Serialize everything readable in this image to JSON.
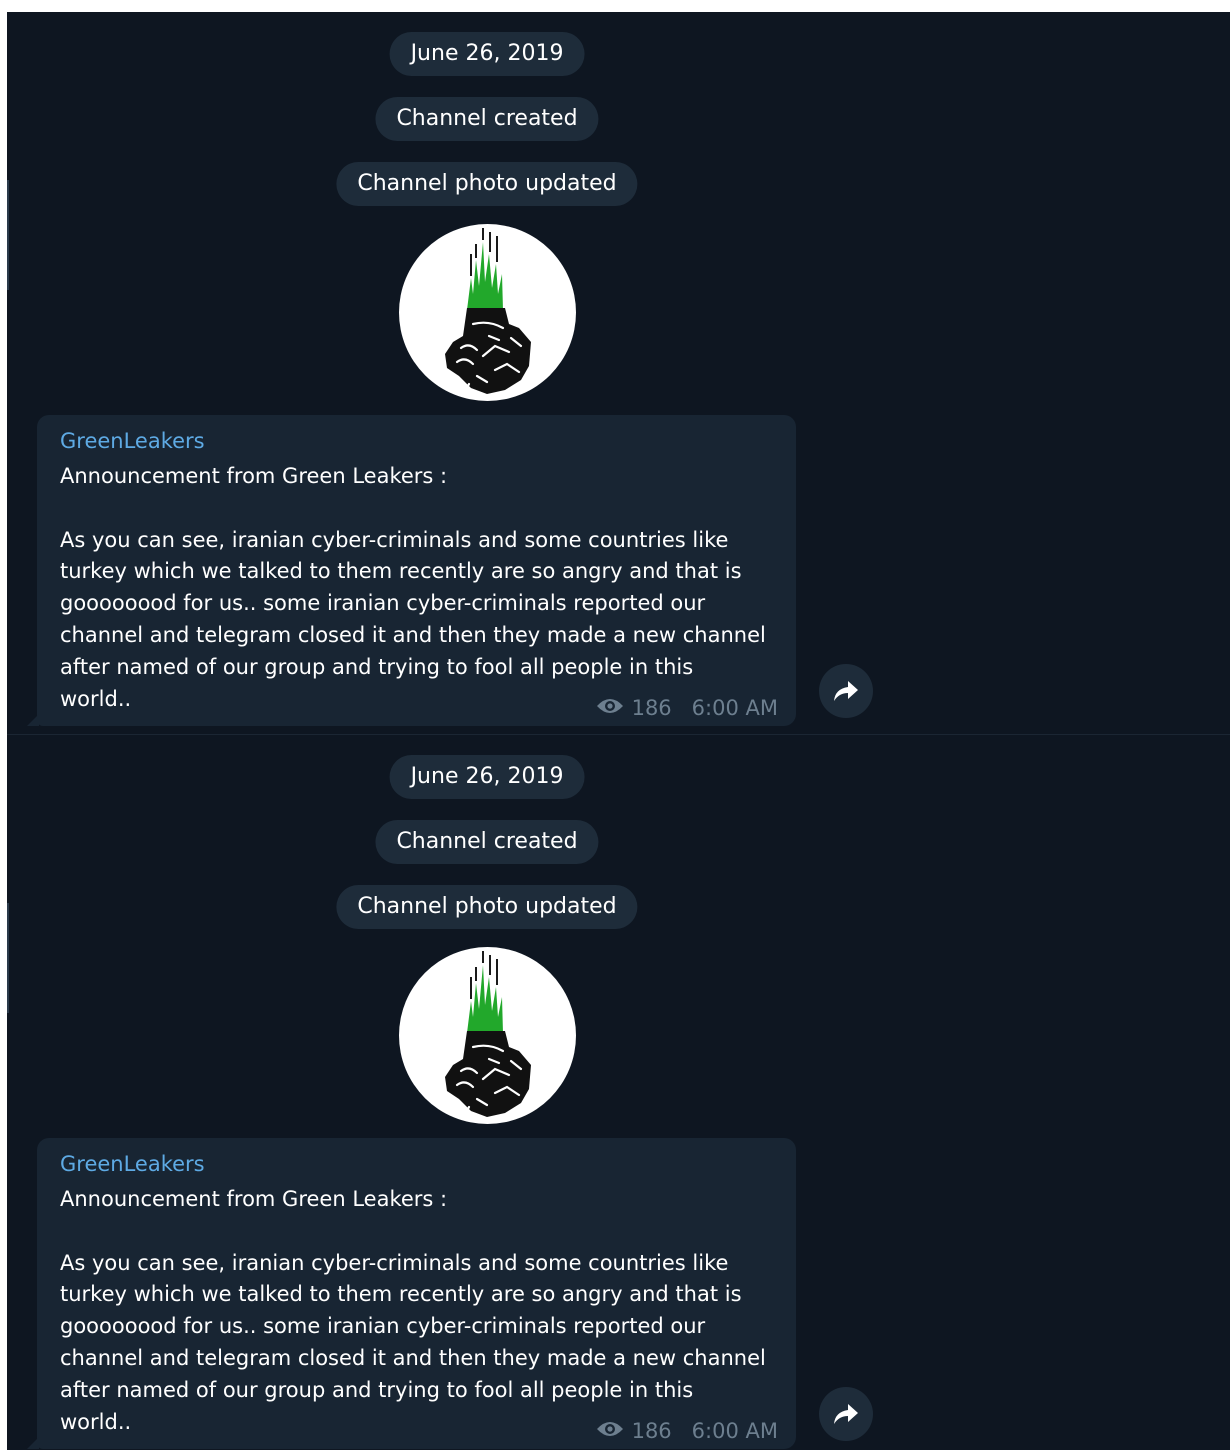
{
  "messages": [
    {
      "date_label": "June 26, 2019",
      "service_created": "Channel created",
      "service_photo": "Channel photo updated",
      "avatar_icon": "green-leakers-fist-logo",
      "author": "GreenLeakers",
      "text": "Announcement from Green Leakers :\n\nAs you can see, iranian cyber-criminals and some countries like\nturkey which we talked to them recently are so angry and that is\ngoooooood for us.. some iranian cyber-criminals reported our\nchannel and telegram closed it and then they made a new channel\nafter named of our group and trying to fool all people in this\nworld..",
      "views": "186",
      "time": "6:00 AM",
      "share_icon": "share-icon"
    },
    {
      "date_label": "June 26, 2019",
      "service_created": "Channel created",
      "service_photo": "Channel photo updated",
      "avatar_icon": "green-leakers-fist-logo",
      "author": "GreenLeakers",
      "text": "Announcement from Green Leakers :\n\nAs you can see, iranian cyber-criminals and some countries like\nturkey which we talked to them recently are so angry and that is\ngoooooood for us.. some iranian cyber-criminals reported our\nchannel and telegram closed it and then they made a new channel\nafter named of our group and trying to fool all people in this\nworld..",
      "views": "186",
      "time": "6:00 AM",
      "share_icon": "share-icon"
    }
  ],
  "colors": {
    "background": "#0e1621",
    "bubble": "#182533",
    "pill": "#1e2c3a",
    "author": "#5eaae4",
    "meta": "#6d7f8f",
    "logo_green": "#22a82b"
  }
}
